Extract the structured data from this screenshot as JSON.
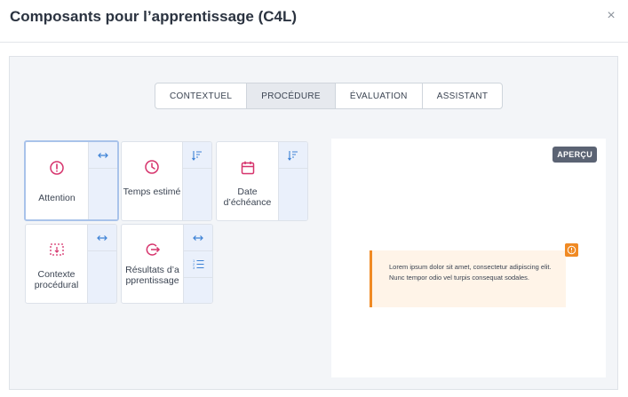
{
  "dialog": {
    "title": "Composants pour l’apprentissage (C4L)",
    "close_label": "×"
  },
  "tabs": [
    {
      "label": "CONTEXTUEL",
      "active": false
    },
    {
      "label": "PROCÉDURE",
      "active": true
    },
    {
      "label": "ÉVALUATION",
      "active": false
    },
    {
      "label": "ASSISTANT",
      "active": false
    }
  ],
  "components": [
    {
      "label": "Attention",
      "icon": "exclamation-circle-icon",
      "selected": true
    },
    {
      "label": "Temps estimé",
      "icon": "clock-icon",
      "selected": false
    },
    {
      "label": "Date d’échéance",
      "icon": "calendar-icon",
      "selected": false
    },
    {
      "label": "Contexte procédural",
      "icon": "dashed-box-icon",
      "selected": false
    },
    {
      "label": "Résultats d’apprentissage",
      "icon": "arrow-out-circle-icon",
      "selected": false
    }
  ],
  "preview": {
    "badge": "APERÇU",
    "callout_text": "Lorem ipsum dolor sit amet, consectetur adipiscing elit. Nunc tempor odio vel turpis consequat sodales."
  },
  "colors": {
    "accent_pink": "#d6336c",
    "accent_blue": "#3d82d6",
    "callout_orange": "#f08a24"
  }
}
